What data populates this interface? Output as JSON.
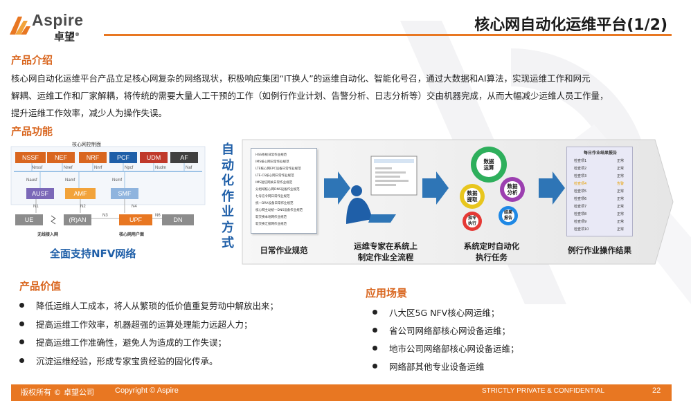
{
  "brand": {
    "logo_en": "Aspire",
    "logo_cn": "卓望",
    "reg": "®"
  },
  "header": {
    "title": "核心网自动化运维平台(1/2)"
  },
  "intro": {
    "heading": "产品介绍",
    "line1": "核心网自动化运维平台产品立足核心网复杂的网络现状，积极响应集团“IT换人”的运维自动化、智能化号召，通过大数据和AI算法，实现运维工作和网元",
    "line2": "解耦、运维工作和厂家解耦，将传统的需要大量人工干预的工作（如例行作业计划、告警分析、日志分析等）交由机器完成，从而大幅减少运维人员工作量，",
    "line3": "提升运维工作效率，减少人为操作失误。"
  },
  "features": {
    "heading": "产品功能",
    "network": {
      "title": "核心网控制面",
      "nfs_top": [
        "NSSF",
        "NEF",
        "NRF",
        "PCF",
        "UDM",
        "AF"
      ],
      "ifs_top": [
        "Nnssf",
        "Nnef",
        "Nnrf",
        "Npcf",
        "Nudm",
        "Naf"
      ],
      "nfs_mid": [
        "AUSF",
        "AMF",
        "SMF"
      ],
      "ifs_mid": [
        "Nausf",
        "Namf",
        "Nsmf"
      ],
      "ifs_low": [
        "N1",
        "N2",
        "N4",
        "N3",
        "N6"
      ],
      "nfs_bottom": [
        "UE",
        "(R)AN",
        "UPF",
        "DN"
      ],
      "cap_left": "无线接入网",
      "cap_right": "核心网用户面",
      "caption": "全面支持NFV网络"
    },
    "flow": {
      "vertical_label": "自动化作业方式",
      "step1": "日常作业规范",
      "step2_line1": "运维专家在系统上",
      "step2_line2": "制定作业全流程",
      "step3_line1": "系统定时自动化",
      "step3_line2": "执行任务",
      "step4": "例行作业操作结果",
      "doc_lines": [
        "HSS系统日常作业规范",
        "IMS核心网日常作业规范",
        "LTE核心网EPC设备日常作业规范",
        "LTE-CS核心网日常作业规范",
        "IMS短信网关日常作业规范",
        "分组域核心网DNS设备作业规范",
        "七号信令网日常作业规范",
        "统一DRA设备日常作业规范",
        "核心网主动统一DNS设备作业规范",
        "软交换本地网作业规范",
        "软交换汇接网作业规范"
      ],
      "gears": {
        "big": [
          "数据",
          "运算"
        ],
        "left": [
          "数据",
          "提取"
        ],
        "right": [
          "数据",
          "分析"
        ],
        "small_left": [
          "指令",
          "执行"
        ],
        "small_right": [
          "结果",
          "报告"
        ]
      },
      "report": {
        "title": "每日作业结果报告",
        "items": [
          "检查项1",
          "检查项2",
          "检查项3",
          "检查项4",
          "检查项5",
          "检查项6",
          "检查项7",
          "检查项8",
          "检查项9",
          "检查项10"
        ],
        "status": [
          "正常",
          "正常",
          "正常",
          "告警",
          "正常",
          "正常",
          "正常",
          "正常",
          "正常",
          "正常"
        ]
      }
    }
  },
  "value": {
    "heading": "产品价值",
    "items": [
      "降低运维人工成本，将人从繁琐的低价值重复劳动中解放出来；",
      "提高运维工作效率，机器超强的运算处理能力远超人力；",
      "提高运维工作准确性，避免人为造成的工作失误；",
      "沉淀运维经验，形成专家宝贵经验的固化传承。"
    ]
  },
  "scenes": {
    "heading": "应用场景",
    "items": [
      "八大区5G NFV核心网运维；",
      "省公司网络部核心网设备运维；",
      "地市公司网络部核心网设备运维；",
      "网络部其他专业设备运维"
    ]
  },
  "footer": {
    "copyright_cn": "版权所有 © 卓望公司",
    "copyright_en": "Copyright © Aspire",
    "confidential": "STRICTLY PRIVATE & CONFIDENTIAL",
    "page": "22"
  },
  "colors": {
    "accent": "#e87722",
    "blue": "#1f5fa8",
    "nf_gray": "#7f7f7f",
    "nf_orange": "#d9661f"
  }
}
